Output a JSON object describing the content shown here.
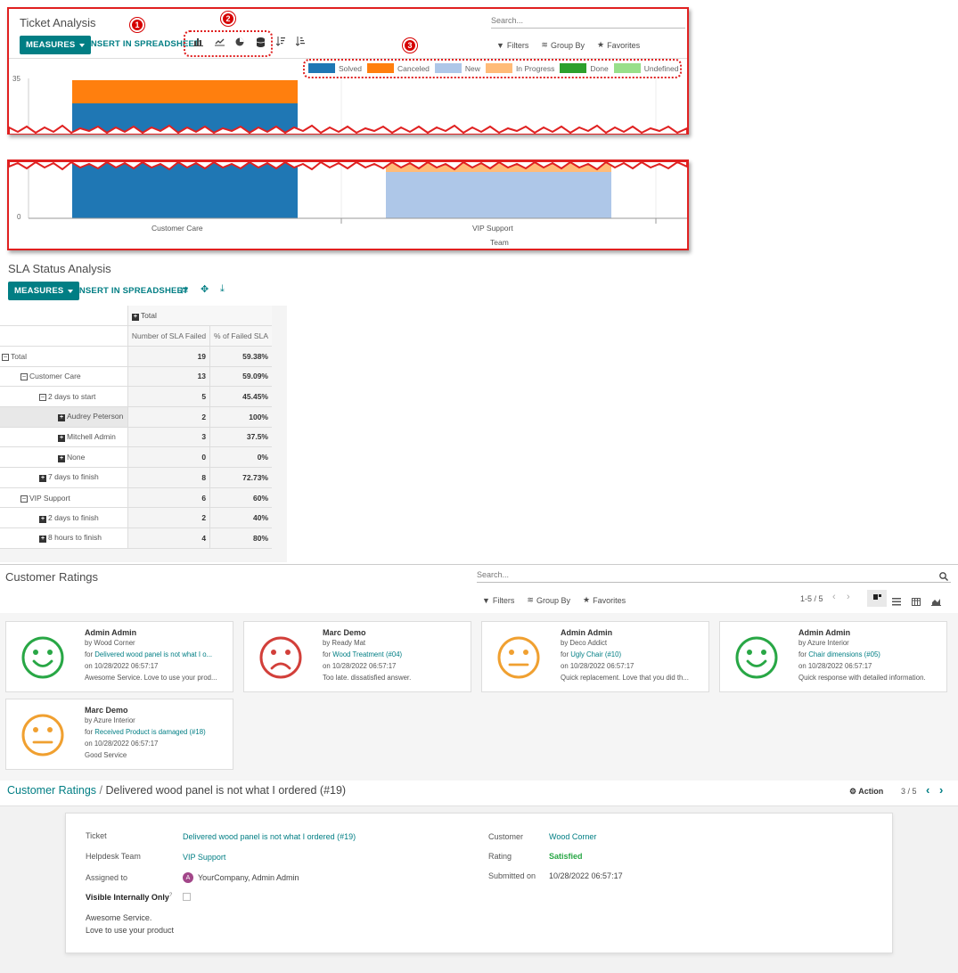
{
  "ticket_analysis": {
    "title": "Ticket Analysis",
    "measures_label": "MEASURES",
    "insert_label": "INSERT IN SPREADSHEET",
    "search_placeholder": "Search...",
    "filters_label": "Filters",
    "group_by_label": "Group By",
    "favorites_label": "Favorites",
    "badges": [
      "1",
      "2",
      "3"
    ],
    "chart_data": {
      "type": "bar",
      "stacked": true,
      "categories": [
        "Customer Care",
        "VIP Support"
      ],
      "xlabel": "Team",
      "ylabel": "",
      "y_ticks": [
        "35",
        "0"
      ],
      "legend_position": "top-right",
      "series": [
        {
          "name": "Solved",
          "color": "#1f77b4"
        },
        {
          "name": "Canceled",
          "color": "#ff7f0e"
        },
        {
          "name": "New",
          "color": "#aec7e8"
        },
        {
          "name": "In Progress",
          "color": "#ffbb78"
        },
        {
          "name": "Done",
          "color": "#2ca02c"
        },
        {
          "name": "Undefined",
          "color": "#98df8a"
        }
      ]
    }
  },
  "sla": {
    "title": "SLA Status Analysis",
    "measures_label": "MEASURES",
    "insert_label": "INSERT IN SPREADSHEET",
    "header_total": "Total",
    "col1": "Number of SLA Failed",
    "col2": "% of Failed SLA",
    "rows": [
      {
        "label": "Total",
        "v1": "19",
        "v2": "59.38%",
        "level": 0,
        "sign": "minus"
      },
      {
        "label": "Customer Care",
        "v1": "13",
        "v2": "59.09%",
        "level": 1,
        "sign": "minus"
      },
      {
        "label": "2 days to start",
        "v1": "5",
        "v2": "45.45%",
        "level": 2,
        "sign": "minus"
      },
      {
        "label": "Audrey Peterson",
        "v1": "2",
        "v2": "100%",
        "level": 3,
        "sign": "plus"
      },
      {
        "label": "Mitchell Admin",
        "v1": "3",
        "v2": "37.5%",
        "level": 3,
        "sign": "plus"
      },
      {
        "label": "None",
        "v1": "0",
        "v2": "0%",
        "level": 3,
        "sign": "plus"
      },
      {
        "label": "7 days to finish",
        "v1": "8",
        "v2": "72.73%",
        "level": 2,
        "sign": "plus"
      },
      {
        "label": "VIP Support",
        "v1": "6",
        "v2": "60%",
        "level": 1,
        "sign": "minus"
      },
      {
        "label": "2 days to finish",
        "v1": "2",
        "v2": "40%",
        "level": 2,
        "sign": "plus"
      },
      {
        "label": "8 hours to finish",
        "v1": "4",
        "v2": "80%",
        "level": 2,
        "sign": "plus"
      }
    ]
  },
  "ratings": {
    "title": "Customer Ratings",
    "search_placeholder": "Search...",
    "filters_label": "Filters",
    "group_by_label": "Group By",
    "favorites_label": "Favorites",
    "pager": "1-5 / 5",
    "cards": [
      {
        "name": "Admin Admin",
        "by": "by Wood Corner",
        "for_prefix": "for",
        "for_link": "Delivered wood panel is not what I o...",
        "date": "on 10/28/2022 06:57:17",
        "comment": "Awesome Service. Love to use your prod...",
        "mood": "happy"
      },
      {
        "name": "Marc Demo",
        "by": "by Ready Mat",
        "for_prefix": "for",
        "for_link": "Wood Treatment (#04)",
        "date": "on 10/28/2022 06:57:17",
        "comment": "Too late. dissatisfied answer.",
        "mood": "sad"
      },
      {
        "name": "Admin Admin",
        "by": "by Deco Addict",
        "for_prefix": "for",
        "for_link": "Ugly Chair (#10)",
        "date": "on 10/28/2022 06:57:17",
        "comment": "Quick replacement. Love that you did th...",
        "mood": "neutral"
      },
      {
        "name": "Admin Admin",
        "by": "by Azure Interior",
        "for_prefix": "for",
        "for_link": "Chair dimensions (#05)",
        "date": "on 10/28/2022 06:57:17",
        "comment": "Quick response with detailed information.",
        "mood": "happy"
      },
      {
        "name": "Marc Demo",
        "by": "by Azure Interior",
        "for_prefix": "for",
        "for_link": "Received Product is damaged (#18)",
        "date": "on 10/28/2022 06:57:17",
        "comment": "Good Service",
        "mood": "neutral"
      }
    ]
  },
  "detail": {
    "breadcrumb_root": "Customer Ratings",
    "breadcrumb_sep": "/",
    "breadcrumb_current": "Delivered wood panel is not what I ordered (#19)",
    "action_label": "Action",
    "pager": "3 / 5",
    "ticket_label": "Ticket",
    "ticket_value": "Delivered wood panel is not what I ordered (#19)",
    "team_label": "Helpdesk Team",
    "team_value": "VIP Support",
    "assigned_label": "Assigned to",
    "assigned_initial": "A",
    "assigned_value": "YourCompany, Admin Admin",
    "visible_label": "Visible Internally Only",
    "visible_help": "?",
    "comment_line1": "Awesome Service.",
    "comment_line2": "Love to use your product",
    "customer_label": "Customer",
    "customer_value": "Wood Corner",
    "rating_label": "Rating",
    "rating_value": "Satisfied",
    "submitted_label": "Submitted on",
    "submitted_value": "10/28/2022 06:57:17"
  }
}
